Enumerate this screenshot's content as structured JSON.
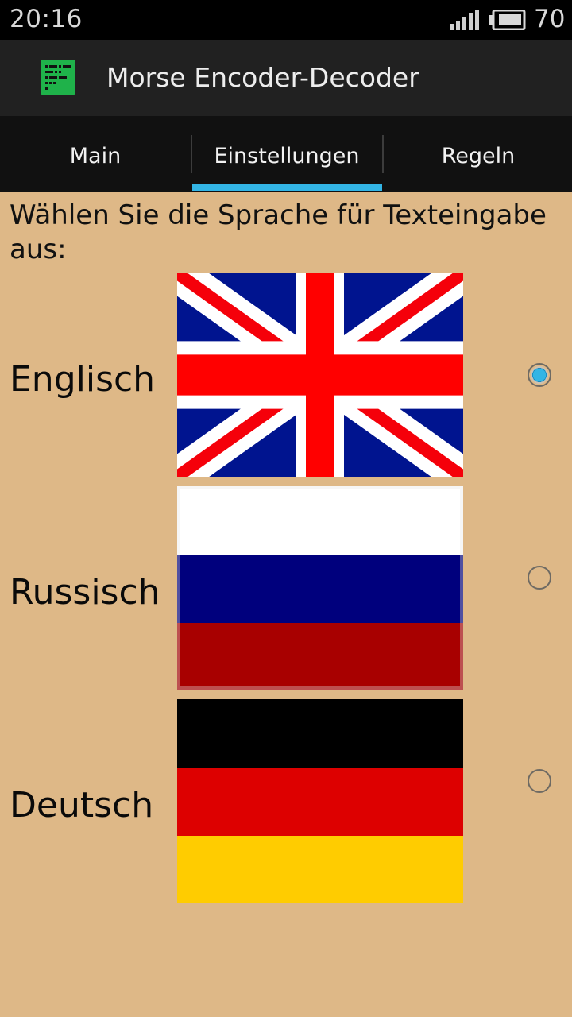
{
  "status_bar": {
    "time": "20:16",
    "battery_level": "70",
    "signal_icon": "signal-icon",
    "battery_icon": "battery-icon"
  },
  "action_bar": {
    "app_icon": "morse-app-icon",
    "title": "Morse Encoder-Decoder"
  },
  "tabs": [
    {
      "label": "Main",
      "selected": false
    },
    {
      "label": "Einstellungen",
      "selected": true
    },
    {
      "label": "Regeln",
      "selected": false
    }
  ],
  "colors": {
    "background": "#deb887",
    "tab_indicator": "#33b5e5",
    "action_bar": "#212121",
    "tab_bar": "#111111"
  },
  "settings": {
    "prompt": "Wählen Sie die Sprache für Texteingabe aus:",
    "languages": [
      {
        "label": "Englisch",
        "flag": "uk-flag",
        "selected": true
      },
      {
        "label": "Russisch",
        "flag": "russia-flag",
        "selected": false
      },
      {
        "label": "Deutsch",
        "flag": "germany-flag",
        "selected": false
      }
    ]
  }
}
